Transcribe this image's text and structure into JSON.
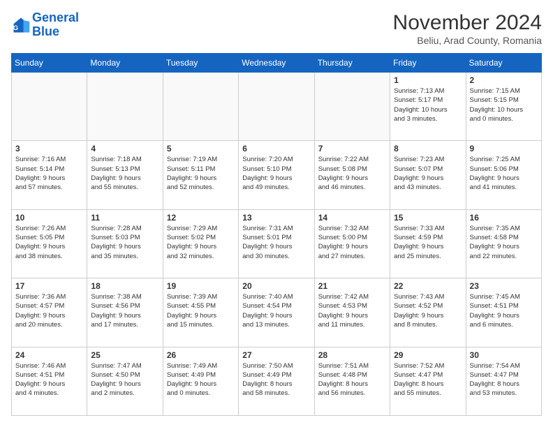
{
  "header": {
    "logo_line1": "General",
    "logo_line2": "Blue",
    "month_title": "November 2024",
    "subtitle": "Beliu, Arad County, Romania"
  },
  "weekdays": [
    "Sunday",
    "Monday",
    "Tuesday",
    "Wednesday",
    "Thursday",
    "Friday",
    "Saturday"
  ],
  "weeks": [
    [
      {
        "day": "",
        "info": ""
      },
      {
        "day": "",
        "info": ""
      },
      {
        "day": "",
        "info": ""
      },
      {
        "day": "",
        "info": ""
      },
      {
        "day": "",
        "info": ""
      },
      {
        "day": "1",
        "info": "Sunrise: 7:13 AM\nSunset: 5:17 PM\nDaylight: 10 hours\nand 3 minutes."
      },
      {
        "day": "2",
        "info": "Sunrise: 7:15 AM\nSunset: 5:15 PM\nDaylight: 10 hours\nand 0 minutes."
      }
    ],
    [
      {
        "day": "3",
        "info": "Sunrise: 7:16 AM\nSunset: 5:14 PM\nDaylight: 9 hours\nand 57 minutes."
      },
      {
        "day": "4",
        "info": "Sunrise: 7:18 AM\nSunset: 5:13 PM\nDaylight: 9 hours\nand 55 minutes."
      },
      {
        "day": "5",
        "info": "Sunrise: 7:19 AM\nSunset: 5:11 PM\nDaylight: 9 hours\nand 52 minutes."
      },
      {
        "day": "6",
        "info": "Sunrise: 7:20 AM\nSunset: 5:10 PM\nDaylight: 9 hours\nand 49 minutes."
      },
      {
        "day": "7",
        "info": "Sunrise: 7:22 AM\nSunset: 5:08 PM\nDaylight: 9 hours\nand 46 minutes."
      },
      {
        "day": "8",
        "info": "Sunrise: 7:23 AM\nSunset: 5:07 PM\nDaylight: 9 hours\nand 43 minutes."
      },
      {
        "day": "9",
        "info": "Sunrise: 7:25 AM\nSunset: 5:06 PM\nDaylight: 9 hours\nand 41 minutes."
      }
    ],
    [
      {
        "day": "10",
        "info": "Sunrise: 7:26 AM\nSunset: 5:05 PM\nDaylight: 9 hours\nand 38 minutes."
      },
      {
        "day": "11",
        "info": "Sunrise: 7:28 AM\nSunset: 5:03 PM\nDaylight: 9 hours\nand 35 minutes."
      },
      {
        "day": "12",
        "info": "Sunrise: 7:29 AM\nSunset: 5:02 PM\nDaylight: 9 hours\nand 32 minutes."
      },
      {
        "day": "13",
        "info": "Sunrise: 7:31 AM\nSunset: 5:01 PM\nDaylight: 9 hours\nand 30 minutes."
      },
      {
        "day": "14",
        "info": "Sunrise: 7:32 AM\nSunset: 5:00 PM\nDaylight: 9 hours\nand 27 minutes."
      },
      {
        "day": "15",
        "info": "Sunrise: 7:33 AM\nSunset: 4:59 PM\nDaylight: 9 hours\nand 25 minutes."
      },
      {
        "day": "16",
        "info": "Sunrise: 7:35 AM\nSunset: 4:58 PM\nDaylight: 9 hours\nand 22 minutes."
      }
    ],
    [
      {
        "day": "17",
        "info": "Sunrise: 7:36 AM\nSunset: 4:57 PM\nDaylight: 9 hours\nand 20 minutes."
      },
      {
        "day": "18",
        "info": "Sunrise: 7:38 AM\nSunset: 4:56 PM\nDaylight: 9 hours\nand 17 minutes."
      },
      {
        "day": "19",
        "info": "Sunrise: 7:39 AM\nSunset: 4:55 PM\nDaylight: 9 hours\nand 15 minutes."
      },
      {
        "day": "20",
        "info": "Sunrise: 7:40 AM\nSunset: 4:54 PM\nDaylight: 9 hours\nand 13 minutes."
      },
      {
        "day": "21",
        "info": "Sunrise: 7:42 AM\nSunset: 4:53 PM\nDaylight: 9 hours\nand 11 minutes."
      },
      {
        "day": "22",
        "info": "Sunrise: 7:43 AM\nSunset: 4:52 PM\nDaylight: 9 hours\nand 8 minutes."
      },
      {
        "day": "23",
        "info": "Sunrise: 7:45 AM\nSunset: 4:51 PM\nDaylight: 9 hours\nand 6 minutes."
      }
    ],
    [
      {
        "day": "24",
        "info": "Sunrise: 7:46 AM\nSunset: 4:51 PM\nDaylight: 9 hours\nand 4 minutes."
      },
      {
        "day": "25",
        "info": "Sunrise: 7:47 AM\nSunset: 4:50 PM\nDaylight: 9 hours\nand 2 minutes."
      },
      {
        "day": "26",
        "info": "Sunrise: 7:49 AM\nSunset: 4:49 PM\nDaylight: 9 hours\nand 0 minutes."
      },
      {
        "day": "27",
        "info": "Sunrise: 7:50 AM\nSunset: 4:49 PM\nDaylight: 8 hours\nand 58 minutes."
      },
      {
        "day": "28",
        "info": "Sunrise: 7:51 AM\nSunset: 4:48 PM\nDaylight: 8 hours\nand 56 minutes."
      },
      {
        "day": "29",
        "info": "Sunrise: 7:52 AM\nSunset: 4:47 PM\nDaylight: 8 hours\nand 55 minutes."
      },
      {
        "day": "30",
        "info": "Sunrise: 7:54 AM\nSunset: 4:47 PM\nDaylight: 8 hours\nand 53 minutes."
      }
    ]
  ]
}
